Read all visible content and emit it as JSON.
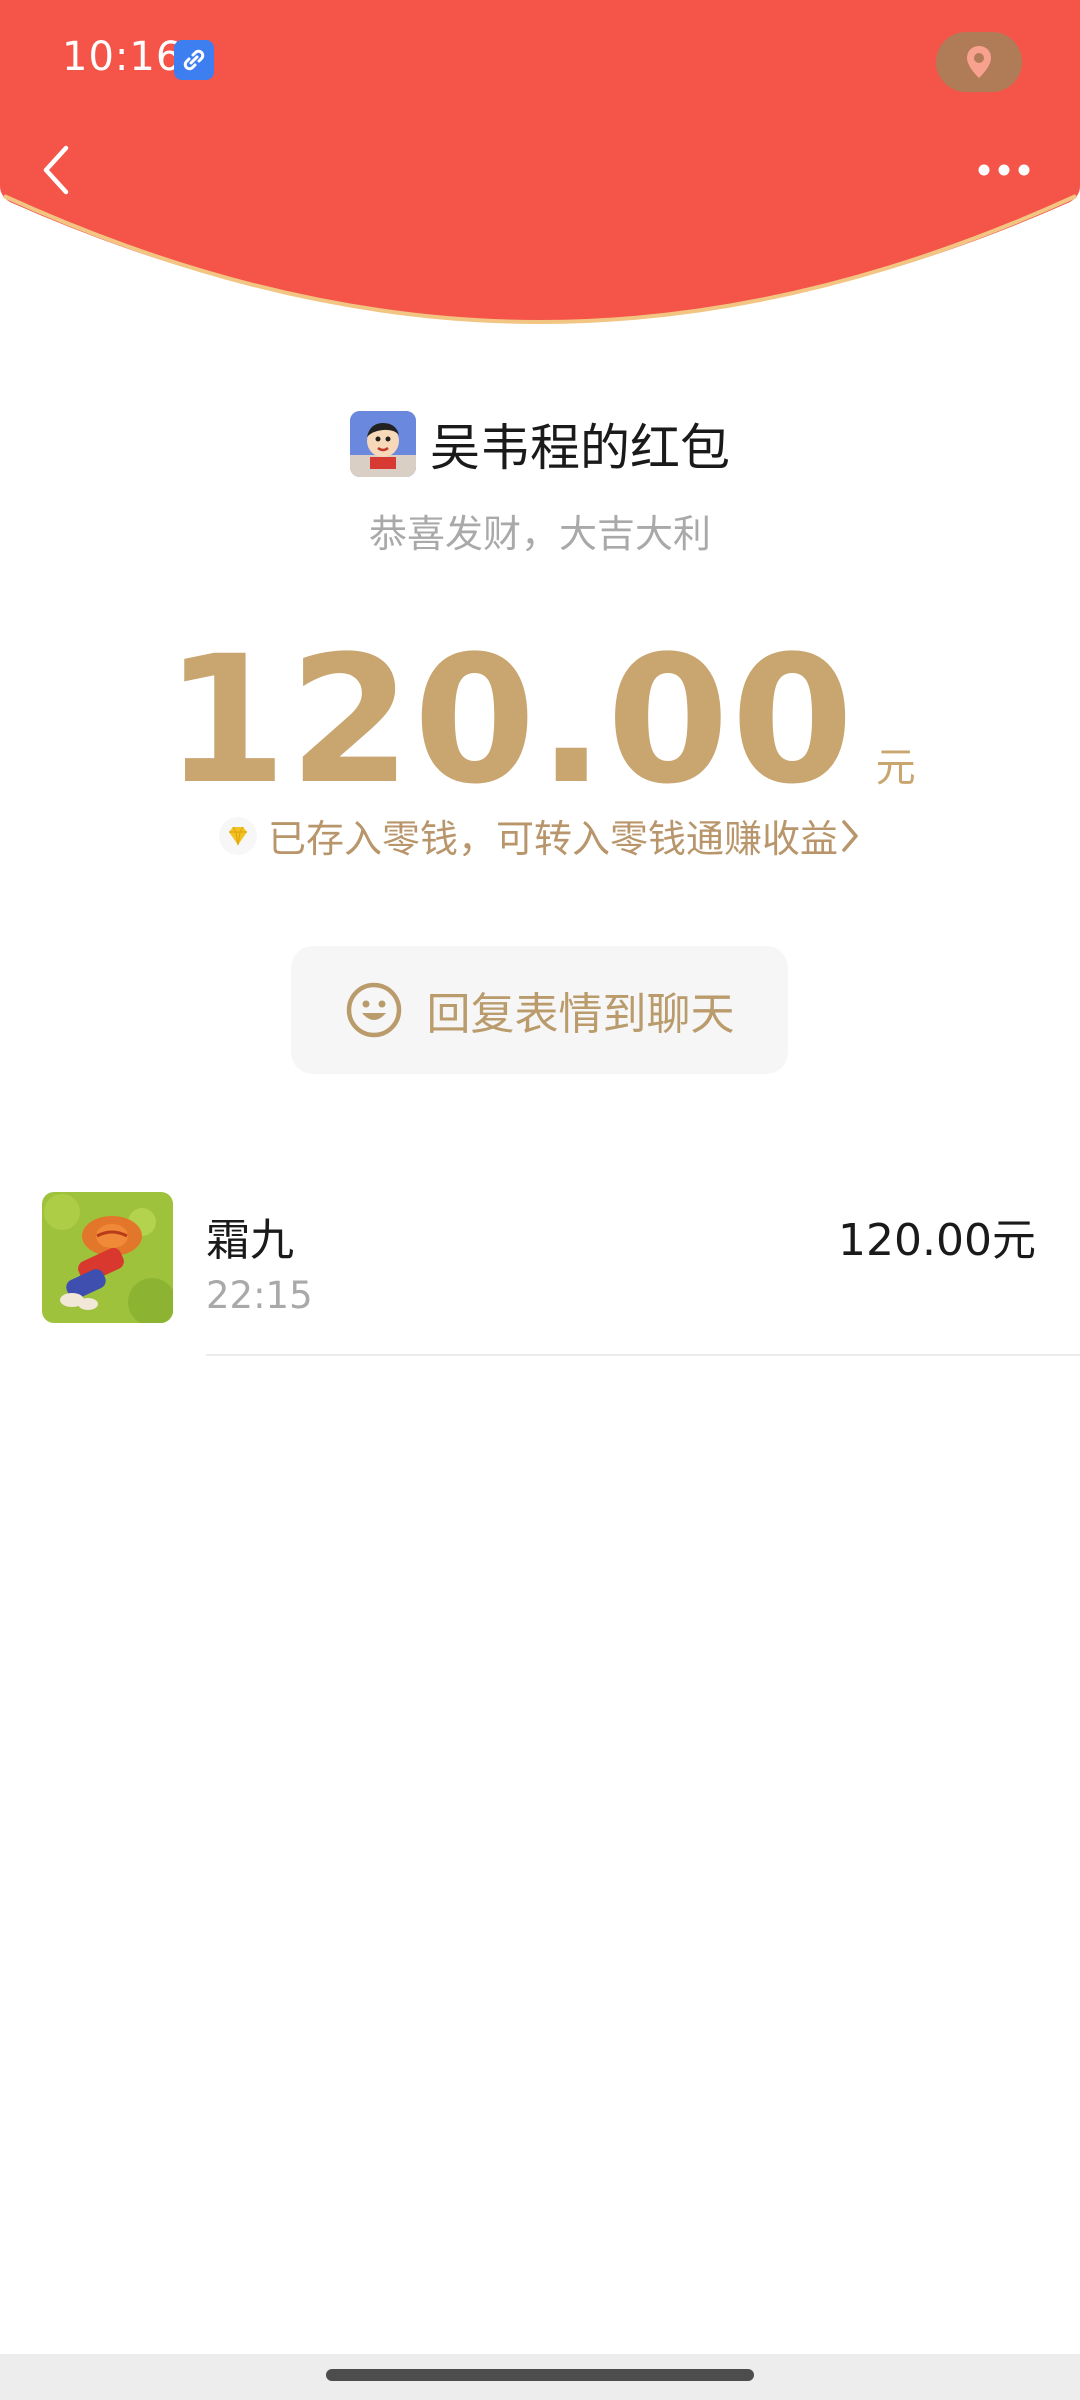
{
  "status_bar": {
    "time": "10:16"
  },
  "colors": {
    "header_red": "#f45548",
    "header_rim": "#f2c582",
    "gold": "#c9a56f",
    "gold_text": "#b8956a"
  },
  "red_packet": {
    "sender_title": "吴韦程的红包",
    "wish": "恭喜发财，大吉大利",
    "amount": "120.00",
    "unit": "元",
    "notice": "已存入零钱，可转入零钱通赚收益",
    "reply_label": "回复表情到聊天"
  },
  "recipients": [
    {
      "name": "霜九",
      "time": "22:15",
      "amount": "120.00元"
    }
  ],
  "icons": {
    "back": "chevron-left-icon",
    "more": "more-dots-icon",
    "location": "location-pin-icon",
    "link": "link-icon",
    "diamond": "diamond-icon",
    "smiley": "smiley-icon",
    "notice_arrow": "chevron-right-icon"
  }
}
